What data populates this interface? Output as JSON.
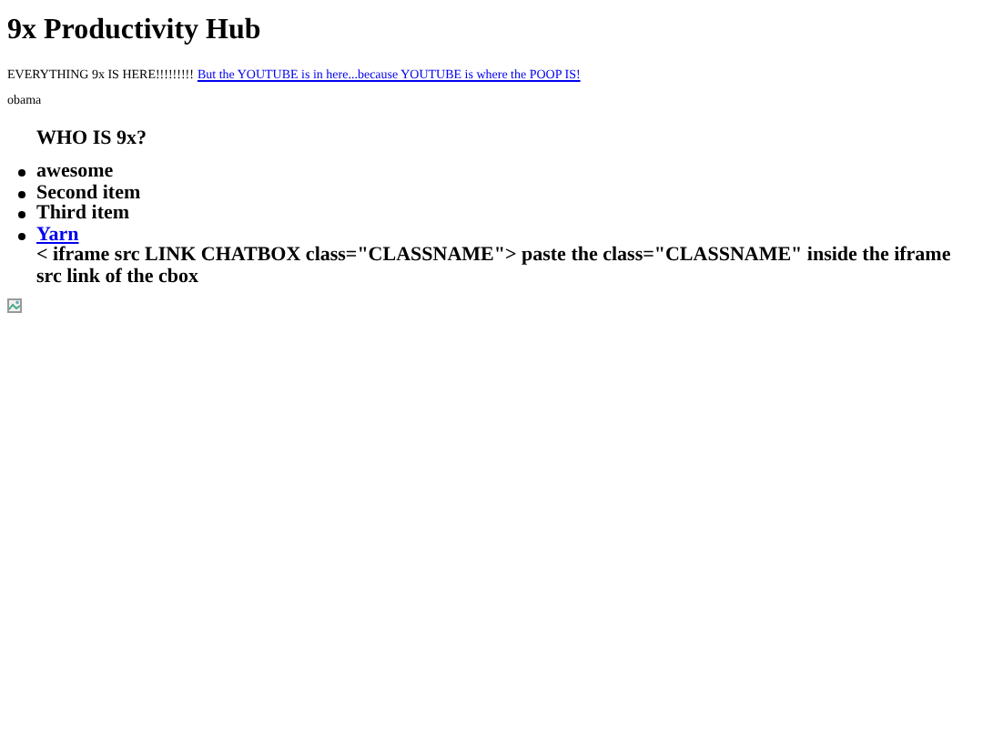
{
  "title": "9x Productivity Hub",
  "intro": {
    "text": "EVERYTHING 9x IS HERE!!!!!!!!!",
    "link": "But the YOUTUBE is in here...because YOUTUBE is where the POOP IS!"
  },
  "caption": "obama",
  "subheading": "WHO IS 9x?",
  "list": [
    {
      "kind": "text",
      "text": "awesome"
    },
    {
      "kind": "text",
      "text": "Second item"
    },
    {
      "kind": "text",
      "text": "Third item"
    },
    {
      "kind": "link",
      "text": "Yarn",
      "note": "< iframe src LINK CHATBOX class=\"CLASSNAME\"> paste the class=\"CLASSNAME\" inside the iframe src link of the cbox"
    }
  ],
  "image": {
    "kind": "broken"
  }
}
